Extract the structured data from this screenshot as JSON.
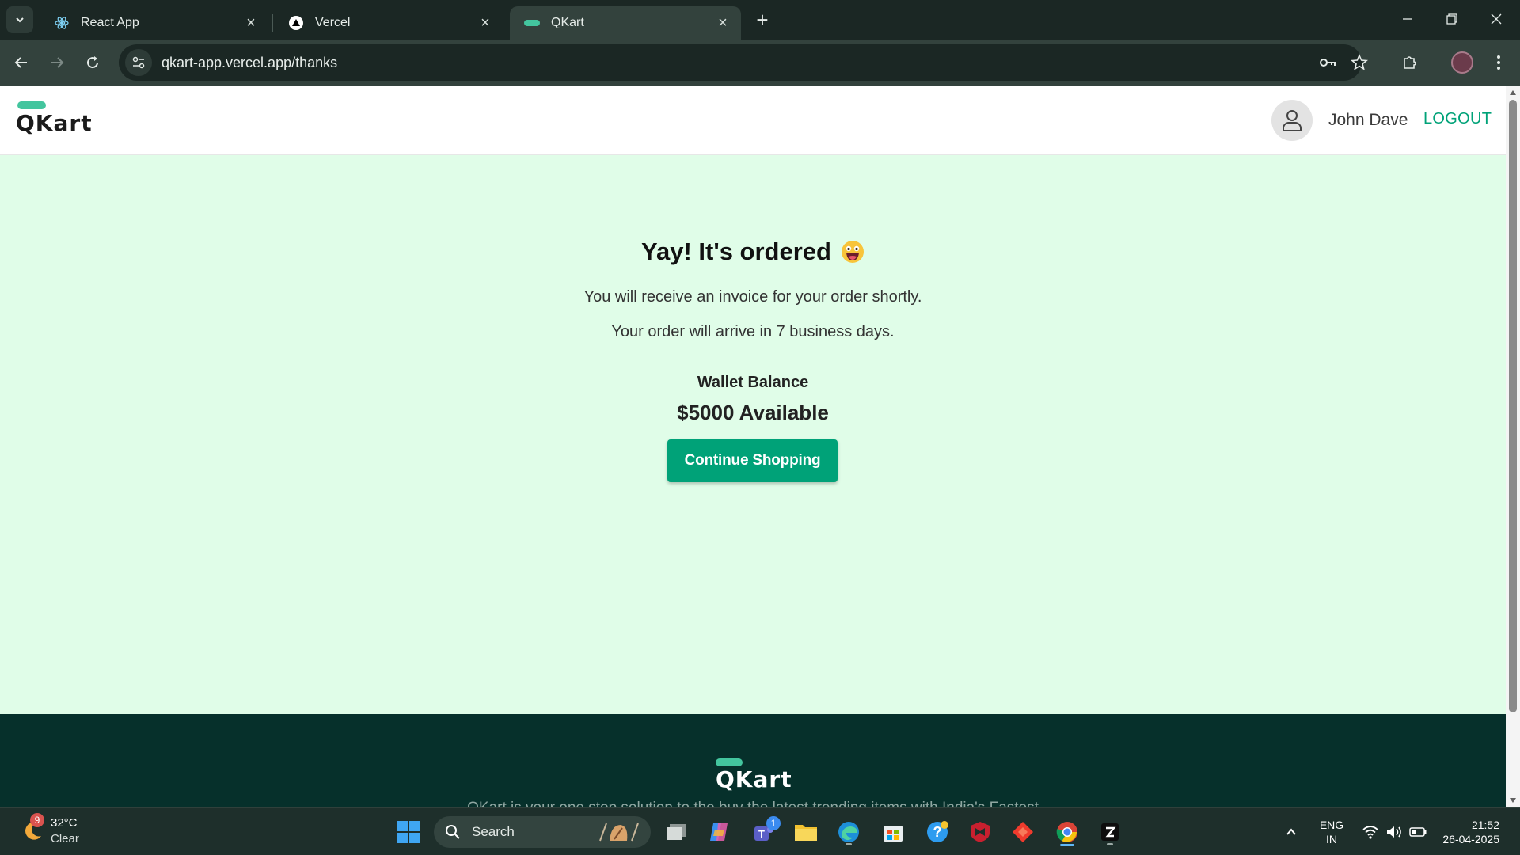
{
  "browser": {
    "tabs": [
      {
        "title": "React App",
        "favicon": "react-icon",
        "active": false
      },
      {
        "title": "Vercel",
        "favicon": "vercel-icon",
        "active": false
      },
      {
        "title": "QKart",
        "favicon": "qkart-icon",
        "active": true
      }
    ],
    "url": "qkart-app.vercel.app/thanks"
  },
  "page": {
    "header": {
      "logo_text": "QKart",
      "username": "John Dave",
      "logout_label": "LOGOUT"
    },
    "thanks": {
      "heading": "Yay! It's ordered",
      "line1": "You will receive an invoice for your order shortly.",
      "line2": "Your order will arrive in 7 business days.",
      "wallet_label": "Wallet Balance",
      "wallet_amount": "$5000 Available",
      "continue_label": "Continue Shopping"
    },
    "footer": {
      "logo_text": "QKart",
      "description": "QKart is your one stop solution to the buy the latest trending items with India's Fastest"
    },
    "colors": {
      "accent": "#00a278",
      "content_bg": "#e0fde8",
      "footer_bg": "#06302b",
      "logo_bar": "#43c59e"
    }
  },
  "taskbar": {
    "weather": {
      "badge": "9",
      "temp": "32°C",
      "condition": "Clear"
    },
    "search_label": "Search",
    "teams_badge": "1",
    "lang": {
      "line1": "ENG",
      "line2": "IN"
    },
    "clock": {
      "time": "21:52",
      "date": "26-04-2025"
    }
  }
}
